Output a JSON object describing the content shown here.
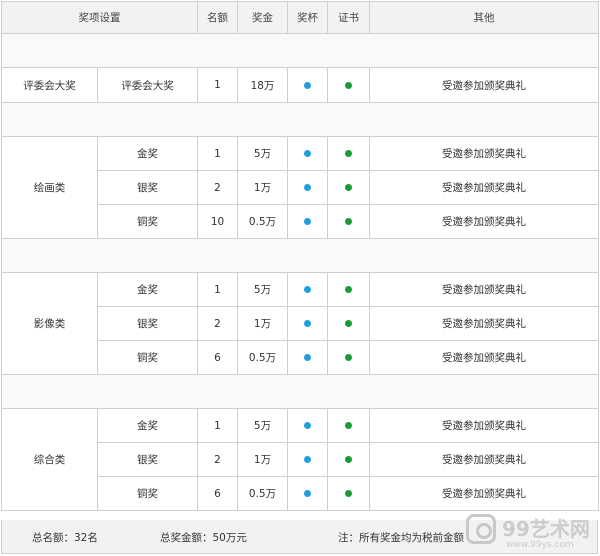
{
  "header": {
    "setting": "奖项设置",
    "count": "名额",
    "prize": "奖金",
    "cup": "奖杯",
    "certificate": "证书",
    "other": "其他"
  },
  "jury": {
    "category": "评委会大奖",
    "level": "评委会大奖",
    "count": "1",
    "prize": "18万",
    "other": "受邀参加颁奖典礼"
  },
  "groups": [
    {
      "category": "绘画类",
      "rows": [
        {
          "level": "金奖",
          "count": "1",
          "prize": "5万",
          "other": "受邀参加颁奖典礼"
        },
        {
          "level": "银奖",
          "count": "2",
          "prize": "1万",
          "other": "受邀参加颁奖典礼"
        },
        {
          "level": "铜奖",
          "count": "10",
          "prize": "0.5万",
          "other": "受邀参加颁奖典礼"
        }
      ]
    },
    {
      "category": "影像类",
      "rows": [
        {
          "level": "金奖",
          "count": "1",
          "prize": "5万",
          "other": "受邀参加颁奖典礼"
        },
        {
          "level": "银奖",
          "count": "2",
          "prize": "1万",
          "other": "受邀参加颁奖典礼"
        },
        {
          "level": "铜奖",
          "count": "6",
          "prize": "0.5万",
          "other": "受邀参加颁奖典礼"
        }
      ]
    },
    {
      "category": "综合类",
      "rows": [
        {
          "level": "金奖",
          "count": "1",
          "prize": "5万",
          "other": "受邀参加颁奖典礼"
        },
        {
          "level": "银奖",
          "count": "2",
          "prize": "1万",
          "other": "受邀参加颁奖典礼"
        },
        {
          "level": "铜奖",
          "count": "6",
          "prize": "0.5万",
          "other": "受邀参加颁奖典礼"
        }
      ]
    }
  ],
  "footer": {
    "total_count": "总名额：32名",
    "total_prize": "总奖金额：50万元",
    "note": "注：所有奖金均为税前金额"
  },
  "watermark": {
    "brand": "99艺术网",
    "url": "www.99ys.com"
  },
  "colors": {
    "cup_dot": "#1f9ee0",
    "certificate_dot": "#1a9b3a",
    "header_bg": "#f2f2f2",
    "border": "#cfcfcf"
  }
}
